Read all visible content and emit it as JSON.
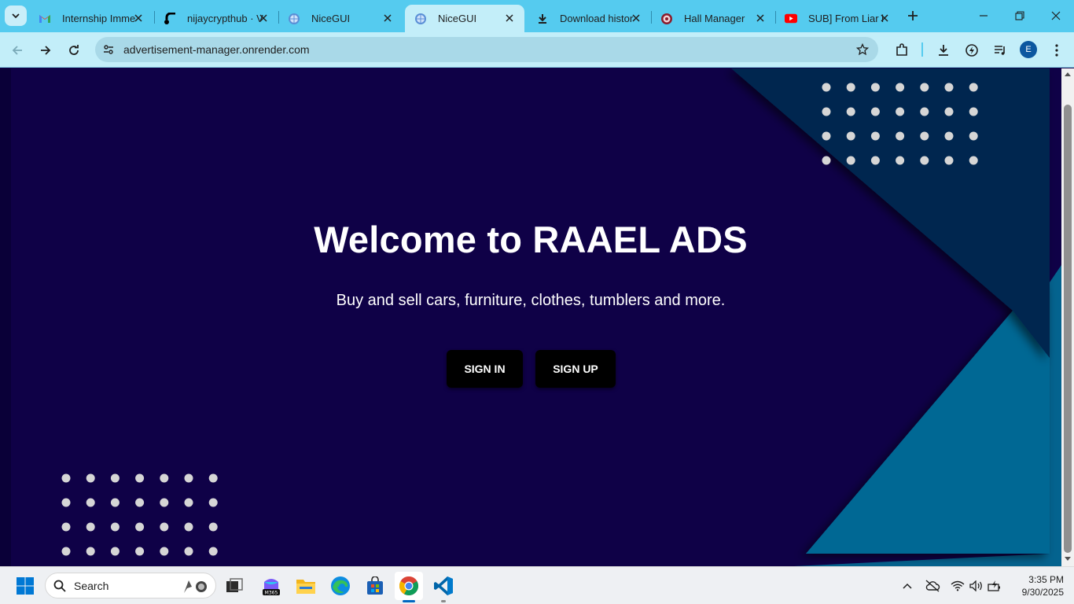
{
  "browser": {
    "tabs": [
      {
        "title": "Internship Imme",
        "icon": "gmail-icon"
      },
      {
        "title": "nijaycrypthub · V",
        "icon": "render-icon"
      },
      {
        "title": "NiceGUI",
        "icon": "nicegui-icon"
      },
      {
        "title": "NiceGUI",
        "icon": "nicegui-icon",
        "active": true
      },
      {
        "title": "Download histor",
        "icon": "download-icon"
      },
      {
        "title": "Hall Manager",
        "icon": "hall-manager-icon"
      },
      {
        "title": "SUB] From Liar i",
        "icon": "youtube-icon"
      }
    ],
    "url": "advertisement-manager.onrender.com",
    "profile_initial": "E"
  },
  "page": {
    "headline": "Welcome to RAAEL ADS",
    "subtitle": "Buy and sell cars, furniture, clothes, tumblers and more.",
    "sign_in_label": "SIGN IN",
    "sign_up_label": "SIGN UP",
    "colors": {
      "background": "#0f0147",
      "shape_dark": "#022850",
      "shape_light": "#04638f",
      "dots": "#d6d6d6",
      "button": "#000000"
    }
  },
  "taskbar": {
    "search_label": "Search",
    "time": "3:35 PM",
    "date": "9/30/2025",
    "apps": [
      "file-explorer",
      "m365-copilot",
      "folder",
      "edge",
      "store",
      "chrome",
      "vscode"
    ]
  }
}
